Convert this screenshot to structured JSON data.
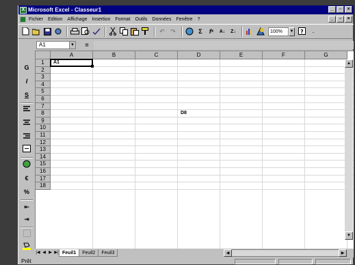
{
  "window": {
    "title": "Microsoft Excel - Classeur1"
  },
  "menu": {
    "items": [
      "Fichier",
      "Edition",
      "Affichage",
      "Insertion",
      "Format",
      "Outils",
      "Données",
      "Fenêtre",
      "?"
    ]
  },
  "toolbar": {
    "zoom": "100%"
  },
  "formula_bar": {
    "name_box": "A1",
    "equals": "="
  },
  "left_toolbar": {
    "bold": "G",
    "italic": "I",
    "underline": "S",
    "euro": "€",
    "percent": "%"
  },
  "sheet": {
    "columns": [
      "A",
      "B",
      "C",
      "D",
      "E",
      "F",
      "G"
    ],
    "rows": [
      "1",
      "2",
      "3",
      "4",
      "5",
      "6",
      "7",
      "8",
      "9",
      "10",
      "11",
      "12",
      "13",
      "14",
      "15",
      "16",
      "17",
      "18"
    ],
    "cells": {
      "A1": "A1",
      "D8": "D8"
    }
  },
  "tabs": [
    "Feuil1",
    "Feuil2",
    "Feuil3"
  ],
  "status": {
    "text": "Prêt"
  }
}
